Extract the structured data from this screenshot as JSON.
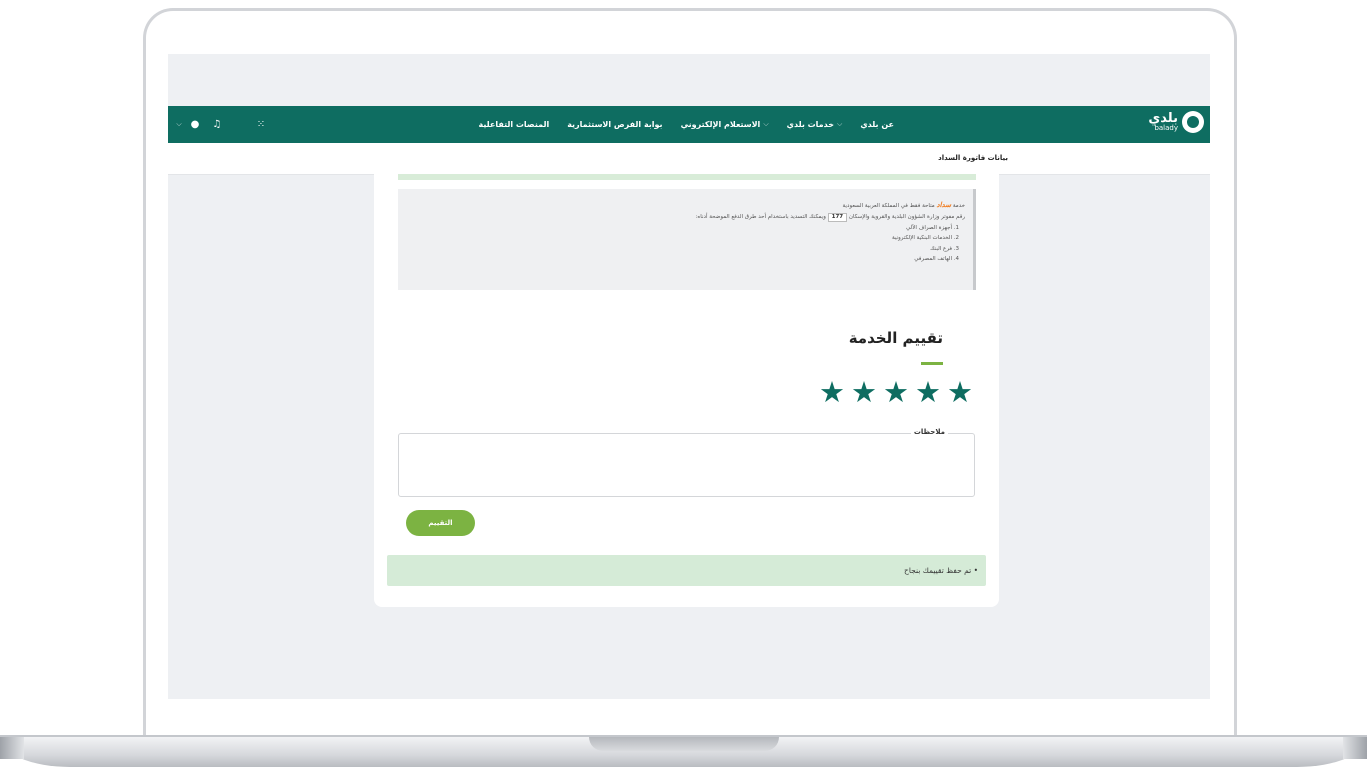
{
  "header": {
    "logo_ar": "بلدي",
    "logo_en": "balady",
    "nav": [
      {
        "label": "عن بلدي",
        "dropdown": false
      },
      {
        "label": "خدمات بلدي",
        "dropdown": true
      },
      {
        "label": "الاستعلام الإلكتروني",
        "dropdown": true
      },
      {
        "label": "بوابة الفرص الاستثمارية",
        "dropdown": false
      },
      {
        "label": "المنصات التفاعلية",
        "dropdown": false
      }
    ],
    "icons": [
      "grid-icon",
      "bell-icon",
      "profile-icon",
      "chevron-down-icon"
    ]
  },
  "page": {
    "title": "بيانات فاتورة السداد"
  },
  "payment_info": {
    "line1_prefix": "خدمة",
    "sadad": "سداد",
    "line1_suffix": "متاحة فقط في المملكة العربية السعودية",
    "line2_prefix": "رقم مفوتر وزارة الشؤون البلدية والقروية والإسكان",
    "biller_number": "177",
    "line2_suffix": "ويمكنك التسديد باستخدام أحد طرق الدفع الموضحة أدناه:",
    "methods": [
      "1. أجهزة الصراف الآلي",
      "2. الخدمات البنكية الإلكترونية",
      "3. فرع البنك",
      "4. الهاتف المصرفي"
    ]
  },
  "rating": {
    "title": "تقييم الخدمة",
    "stars": 5,
    "max_stars": 5,
    "star_color": "#0e6d61",
    "notes_label": "ملاحظات",
    "notes_value": "",
    "submit_label": "التقييم",
    "success_message": "• تم حفظ تقييمك بنجاح"
  },
  "colors": {
    "primary": "#0e6d61",
    "accent": "#7cb342",
    "success_bg": "#d5ebd7"
  }
}
